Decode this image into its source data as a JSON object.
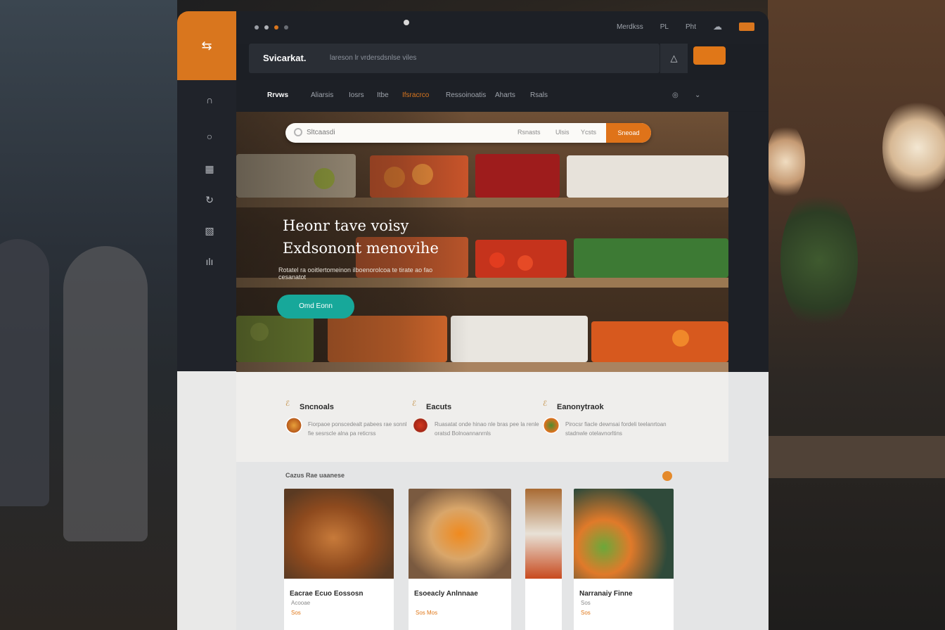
{
  "app": {
    "brand": "Svicarkat.",
    "tagline": "lareson lr vrdersdsnlse viles",
    "top_links": [
      "Merdkss",
      "PL",
      "Pht"
    ],
    "top_cta_label": "",
    "accent_color": "#d9761e",
    "teal_color": "#17a89a"
  },
  "nav": {
    "items": [
      "Rrvws",
      "Aliarsis",
      "Iosrs",
      "Itbe",
      "Ifsracrco",
      "Ressoinoatis",
      "Aharts",
      "Rsals"
    ]
  },
  "search": {
    "placeholder": "Sltcaasdi",
    "filters": [
      "Rsnasts",
      "Ulsis",
      "Ycsts"
    ],
    "go_label": "Sneoad"
  },
  "hero": {
    "title_line1": "Heonr tave voisy",
    "title_line2": "Exdsonont menovihe",
    "subtitle": "Rotatel ra ooitlertomeinon ilboenorolcoa te tirate ao fao cesanatot",
    "cta_label": "Omd Eonn"
  },
  "features": [
    {
      "title": "Sncnoals",
      "desc": "Fiorpaoe ponscedealt pabees rae sonnl fie sesrscle alna pa reticrss"
    },
    {
      "title": "Eacuts",
      "desc": "Ruasatat onde hinao nle bras pee la renle oratsd Bolnoannanrnls"
    },
    {
      "title": "Eanonytraok",
      "desc": "Pirocsr fiacle dewnsai fordeli teelanrtoan stadnwle otelavnorltins"
    }
  ],
  "listing": {
    "section_title": "Cazus Rae uaanese",
    "cards": [
      {
        "title": "Eacrae Ecuo Eossosn",
        "meta": "Acooae",
        "price": "Sos"
      },
      {
        "title": "Esoeacly Anlnnaae",
        "meta": "",
        "price": "Sos Mos"
      },
      {
        "title": "",
        "meta": "",
        "price": ""
      },
      {
        "title": "Narranaiy Finne",
        "meta": "Sos",
        "price": "Sos"
      }
    ]
  }
}
